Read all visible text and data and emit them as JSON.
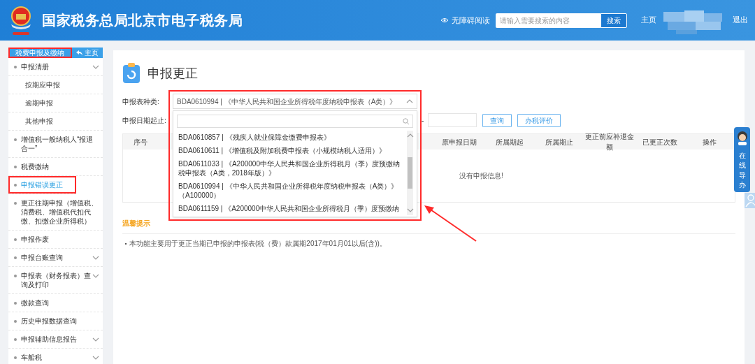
{
  "header": {
    "title": "国家税务总局北京市电子税务局",
    "accessibility_link": "无障碍阅读",
    "search": {
      "placeholder": "请输入需要搜索的内容",
      "button": "搜索"
    },
    "home_link": "主页",
    "logout_link": "退出"
  },
  "sidebar": {
    "section": {
      "label": "税费申报及缴纳",
      "annotated": true
    },
    "back_button": "主页",
    "items": [
      {
        "label": "申报清册",
        "has_submenu": true,
        "selected": false,
        "annotated": false,
        "children": [
          {
            "label": "按期应申报"
          },
          {
            "label": "逾期申报"
          },
          {
            "label": "其他申报"
          }
        ]
      },
      {
        "label": "增值税一般纳税人“报退合一”",
        "has_submenu": false,
        "selected": false,
        "annotated": false
      },
      {
        "label": "税费缴纳",
        "has_submenu": false,
        "selected": false,
        "annotated": false
      },
      {
        "label": "申报错误更正",
        "has_submenu": false,
        "selected": true,
        "annotated": true
      },
      {
        "label": "更正往期申报（增值税、消费税、增值税代扣代缴、扣缴企业所得税）",
        "has_submenu": false,
        "selected": false,
        "annotated": false
      },
      {
        "label": "申报作废",
        "has_submenu": false,
        "selected": false,
        "annotated": false
      },
      {
        "label": "申报台账查询",
        "has_submenu": true,
        "selected": false,
        "annotated": false
      },
      {
        "label": "申报表（财务报表）查询及打印",
        "has_submenu": true,
        "selected": false,
        "annotated": false
      },
      {
        "label": "缴款查询",
        "has_submenu": false,
        "selected": false,
        "annotated": false
      },
      {
        "label": "历史申报数据查询",
        "has_submenu": false,
        "selected": false,
        "annotated": false
      },
      {
        "label": "申报辅助信息报告",
        "has_submenu": true,
        "selected": false,
        "annotated": false
      },
      {
        "label": "车船税",
        "has_submenu": true,
        "selected": false,
        "annotated": false
      }
    ]
  },
  "page": {
    "title": "申报更正",
    "form_type": {
      "label": "申报表种类:",
      "value": "BDA0610994 | 《中华人民共和国企业所得税年度纳税申报表（A类）》",
      "expanded": true,
      "annotated": true,
      "options": [
        "BDA0610857 | 《残疾人就业保障金缴费申报表》",
        "BDA0610611 | 《增值税及附加税费申报表（小规模纳税人适用）》",
        "BDA0611033 | 《A200000中华人民共和国企业所得税月（季）度预缴纳税申报表（A类，2018年版）》",
        "BDA0610994 | 《中华人民共和国企业所得税年度纳税申报表（A类）》（A100000）",
        "BDA0611159 | 《A200000中华人民共和国企业所得税月（季）度预缴纳"
      ]
    },
    "date_range": {
      "label": "申报日期起止:",
      "separator": "-"
    },
    "buttons": [
      "查询",
      "办税评价"
    ],
    "table": {
      "columns": [
        "序号",
        "原申报日期",
        "所属期起",
        "所属期止",
        "更正前应补退金额",
        "已更正次数",
        "操作"
      ],
      "empty_message": "没有申报信息!"
    },
    "tips": {
      "title": "温馨提示",
      "items": [
        "本功能主要用于更正当期已申报的申报表(税（费）款属期2017年01月01以后(含))。"
      ]
    }
  },
  "side_widget": {
    "label": "在线导办"
  }
}
